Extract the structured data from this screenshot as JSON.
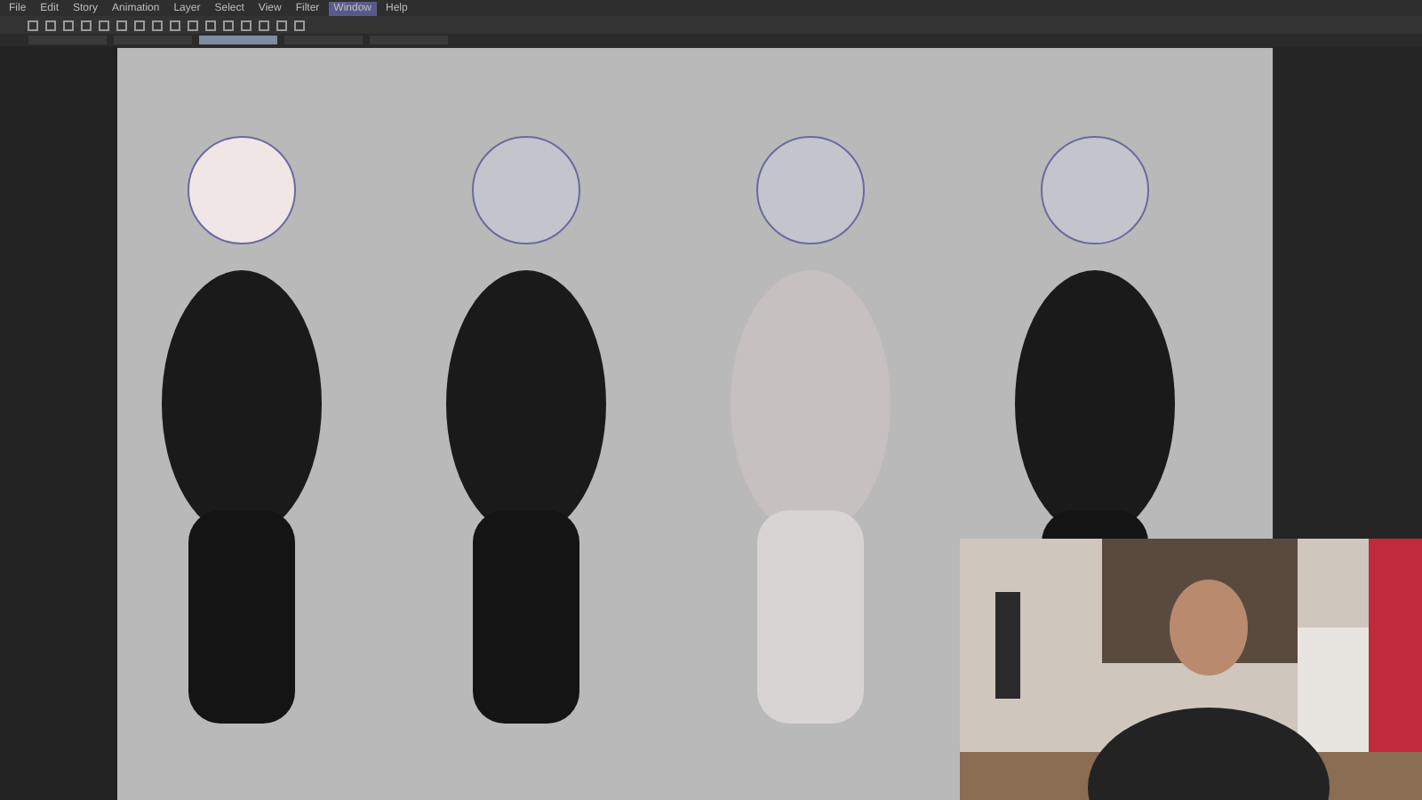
{
  "menu": [
    {
      "label": "File",
      "selected": false
    },
    {
      "label": "Edit",
      "selected": false
    },
    {
      "label": "Story",
      "selected": false
    },
    {
      "label": "Animation",
      "selected": false
    },
    {
      "label": "Layer",
      "selected": false
    },
    {
      "label": "Select",
      "selected": false
    },
    {
      "label": "View",
      "selected": false
    },
    {
      "label": "Filter",
      "selected": false
    },
    {
      "label": "Window",
      "selected": true
    },
    {
      "label": "Help",
      "selected": false
    }
  ],
  "tabs": [
    {
      "selected": false
    },
    {
      "selected": false
    },
    {
      "selected": true
    },
    {
      "selected": false
    },
    {
      "selected": false
    }
  ]
}
